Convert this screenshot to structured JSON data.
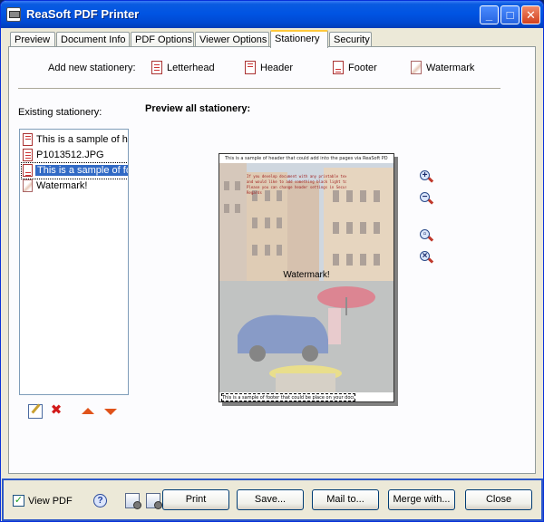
{
  "window": {
    "title": "ReaSoft PDF Printer",
    "minimize": "_",
    "maximize": "□",
    "close": "✕"
  },
  "tabs": [
    {
      "label": "Preview"
    },
    {
      "label": "Document Info"
    },
    {
      "label": "PDF Options"
    },
    {
      "label": "Viewer Options"
    },
    {
      "label": "Stationery",
      "active": true
    },
    {
      "label": "Security"
    }
  ],
  "stationery": {
    "add_new_label": "Add new stationery:",
    "add_items": [
      {
        "label": "Letterhead",
        "icon": "letterhead-icon"
      },
      {
        "label": "Header",
        "icon": "header-icon"
      },
      {
        "label": "Footer",
        "icon": "footer-icon"
      },
      {
        "label": "Watermark",
        "icon": "watermark-icon"
      }
    ],
    "existing_label": "Existing stationery:",
    "preview_label": "Preview all stationery:",
    "existing_items": [
      {
        "label": "This is a sample of he",
        "icon": "document-icon"
      },
      {
        "label": "P1013512.JPG",
        "icon": "image-document-icon"
      },
      {
        "label": "This is a sample of fo",
        "icon": "document-icon",
        "selected": true
      },
      {
        "label": "Watermark!",
        "icon": "watermark-icon"
      }
    ]
  },
  "preview_page": {
    "header_text": "This is a sample of header that could add into the pages via ReaSoft PDF printer",
    "body_lines": [
      "If you develop document with any printable text",
      "and would like to add something black light to some things before",
      "",
      "Please you can change header settings in Security settings",
      "",
      "Regards"
    ],
    "watermark_text": "Watermark!",
    "footer_text": "This is a sample of footer that could be place on your document"
  },
  "zoom_tools": {
    "zoom_in": "+",
    "zoom_out": "−",
    "fit": "▫",
    "actual": "×"
  },
  "bottom": {
    "view_pdf_label": "View PDF",
    "view_pdf_checked": "✓",
    "help_glyph": "?",
    "buttons": {
      "print": "Print",
      "save": "Save...",
      "mail": "Mail to...",
      "merge": "Merge with...",
      "close": "Close"
    }
  }
}
